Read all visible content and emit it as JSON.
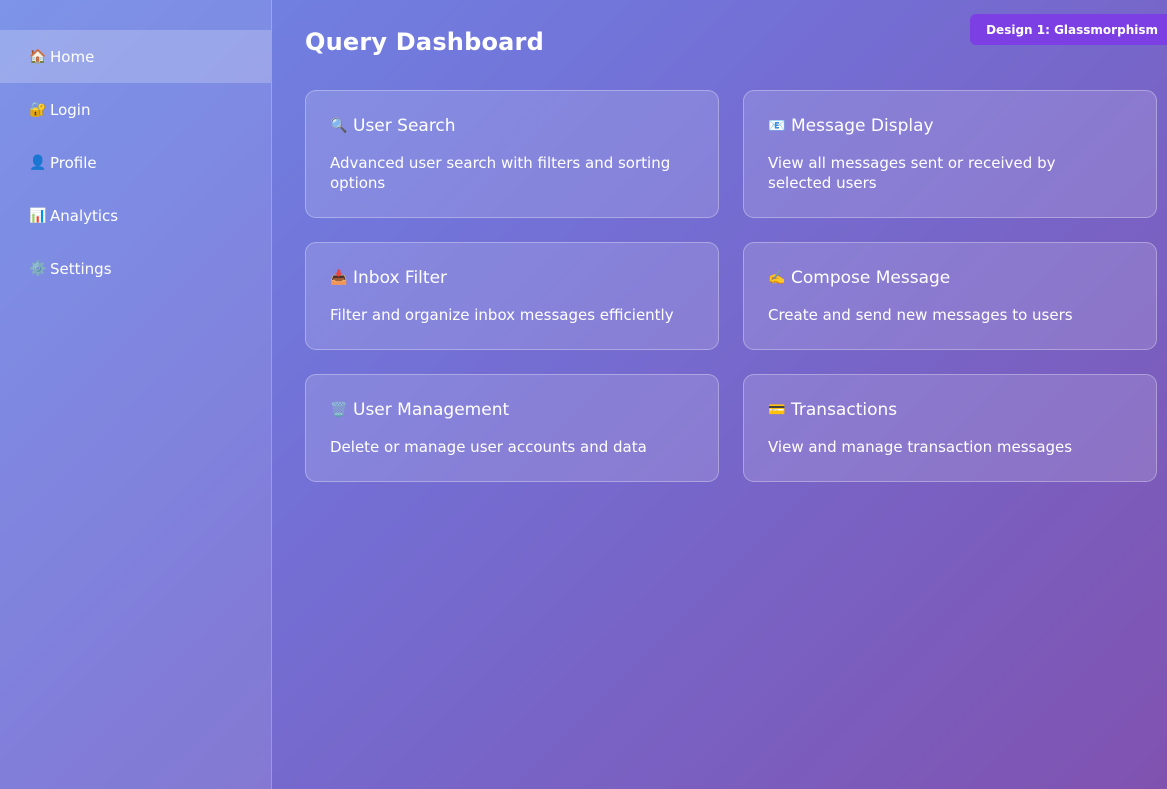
{
  "sidebar": {
    "items": [
      {
        "icon": "🏠",
        "icon_name": "home-icon",
        "label": "Home",
        "active": true
      },
      {
        "icon": "🔐",
        "icon_name": "lock-key-icon",
        "label": "Login",
        "active": false
      },
      {
        "icon": "👤",
        "icon_name": "user-icon",
        "label": "Profile",
        "active": false
      },
      {
        "icon": "📊",
        "icon_name": "bar-chart-icon",
        "label": "Analytics",
        "active": false
      },
      {
        "icon": "⚙️",
        "icon_name": "gear-icon",
        "label": "Settings",
        "active": false
      }
    ]
  },
  "header": {
    "title": "Query Dashboard",
    "badge": "Design 1: Glassmorphism"
  },
  "cards": [
    {
      "icon": "🔍",
      "icon_name": "magnifier-icon",
      "title": "User Search",
      "description": "Advanced user search with filters and sorting options"
    },
    {
      "icon": "📧",
      "icon_name": "email-icon",
      "title": "Message Display",
      "description": "View all messages sent or received by selected users"
    },
    {
      "icon": "📥",
      "icon_name": "inbox-tray-icon",
      "title": "Inbox Filter",
      "description": "Filter and organize inbox messages efficiently"
    },
    {
      "icon": "✍️",
      "icon_name": "writing-hand-icon",
      "title": "Compose Message",
      "description": "Create and send new messages to users"
    },
    {
      "icon": "🗑️",
      "icon_name": "trash-icon",
      "title": "User Management",
      "description": "Delete or manage user accounts and data"
    },
    {
      "icon": "💳",
      "icon_name": "credit-card-icon",
      "title": "Transactions",
      "description": "View and manage transaction messages"
    }
  ],
  "colors": {
    "badge_background": "#7c3fe4",
    "gradient_start": "#6f88e6",
    "gradient_end": "#8052b0"
  }
}
